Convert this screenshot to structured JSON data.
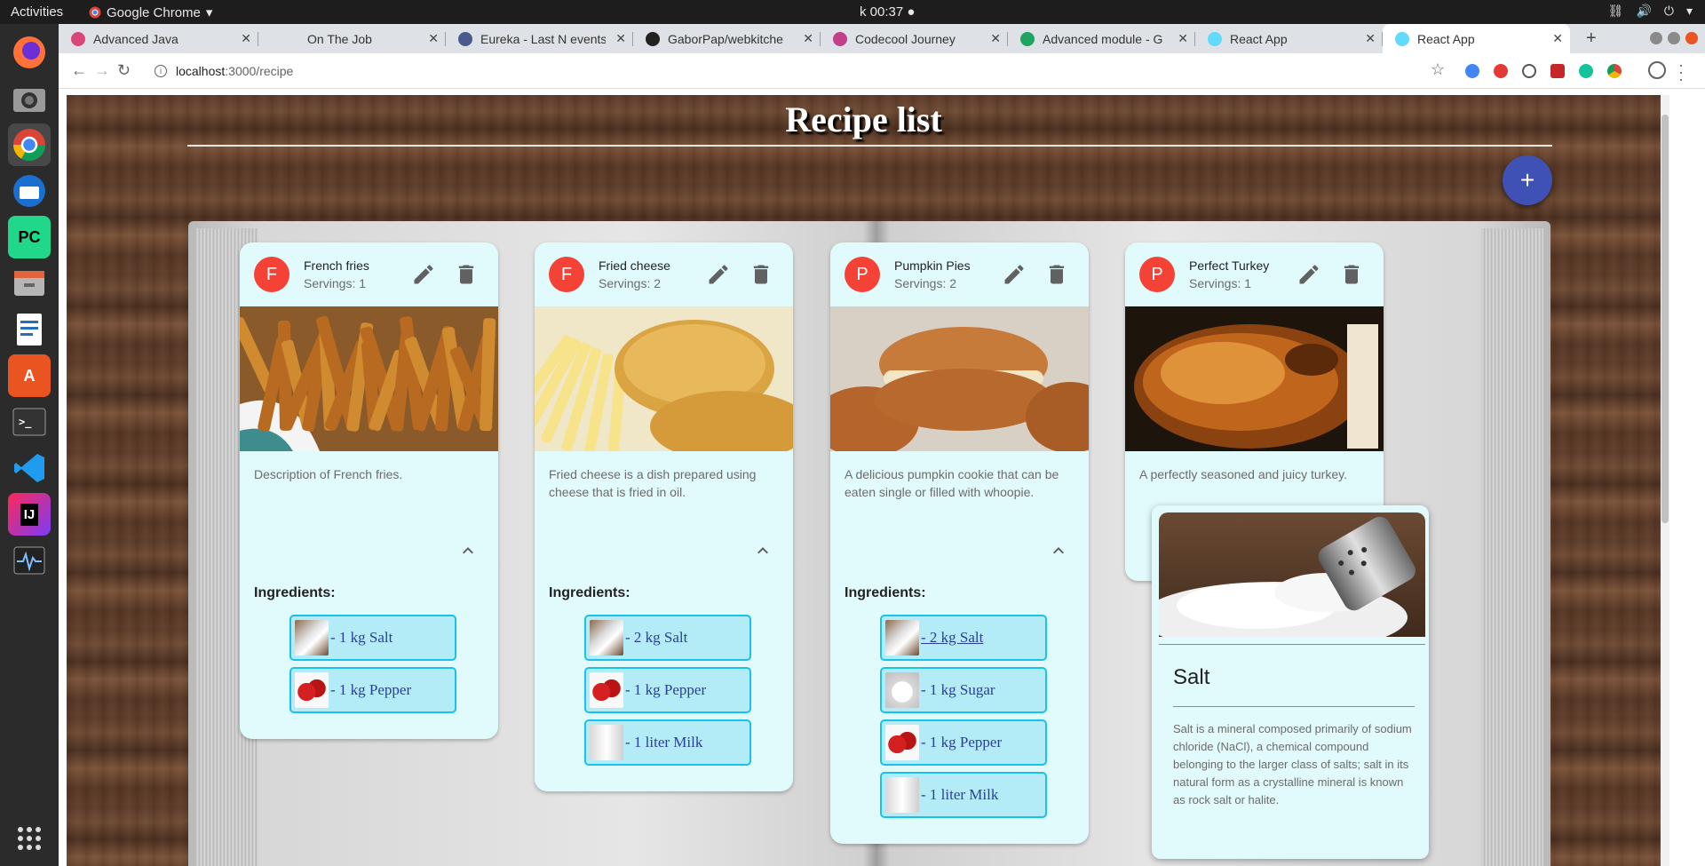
{
  "system": {
    "activities": "Activities",
    "app_name": "Google Chrome",
    "clock": "k 00:37 ●"
  },
  "browser": {
    "tabs": [
      {
        "label": "Advanced Java",
        "icon": "codecool-icon"
      },
      {
        "label": "On The Job",
        "icon": "blank-page-icon"
      },
      {
        "label": "Eureka - Last N events",
        "icon": "eureka-icon"
      },
      {
        "label": "GaborPap/webkitche",
        "icon": "github-icon"
      },
      {
        "label": "Codecool Journey",
        "icon": "codecool-icon"
      },
      {
        "label": "Advanced module - G",
        "icon": "google-drive-icon"
      },
      {
        "label": "React App",
        "icon": "react-icon"
      },
      {
        "label": "React App",
        "icon": "react-icon",
        "active": true
      }
    ],
    "url_host": "localhost",
    "url_path": ":3000/recipe"
  },
  "page": {
    "title": "Recipe list",
    "add_label": "+"
  },
  "recipes": [
    {
      "avatar": "F",
      "title": "French fries",
      "servings": "Servings: 1",
      "description": "Description of French fries.",
      "image": "french-fries-photo",
      "ingredients_label": "Ingredients:",
      "ingredients": [
        {
          "text": "- 1 kg Salt",
          "thumb": "salt-photo"
        },
        {
          "text": "- 1 kg Pepper",
          "thumb": "pepper-photo"
        }
      ]
    },
    {
      "avatar": "F",
      "title": "Fried cheese",
      "servings": "Servings: 2",
      "description": "Fried cheese is a dish prepared using cheese that is fried in oil.",
      "image": "fried-cheese-photo",
      "ingredients_label": "Ingredients:",
      "ingredients": [
        {
          "text": "- 2 kg Salt",
          "thumb": "salt-photo"
        },
        {
          "text": "- 1 kg Pepper",
          "thumb": "pepper-photo"
        },
        {
          "text": "- 1 liter Milk",
          "thumb": "milk-photo"
        }
      ]
    },
    {
      "avatar": "P",
      "title": "Pumpkin Pies",
      "servings": "Servings: 2",
      "description": "A delicious pumpkin cookie that can be eaten single or filled with whoopie.",
      "image": "pumpkin-pie-photo",
      "ingredients_label": "Ingredients:",
      "ingredients": [
        {
          "text": "- 2 kg Salt",
          "thumb": "salt-photo"
        },
        {
          "text": "- 1 kg Sugar",
          "thumb": "sugar-photo"
        },
        {
          "text": "- 1 kg Pepper",
          "thumb": "pepper-photo"
        },
        {
          "text": "- 1 liter Milk",
          "thumb": "milk-photo"
        }
      ]
    },
    {
      "avatar": "P",
      "title": "Perfect Turkey",
      "servings": "Servings: 1",
      "description": "A perfectly seasoned and juicy turkey.",
      "image": "turkey-photo"
    }
  ],
  "popup": {
    "title": "Salt",
    "description": "Salt is a mineral composed primarily of sodium chloride (NaCl), a chemical compound belonging to the larger class of salts; salt in its natural form as a crystalline mineral is known as rock salt or halite.",
    "image": "salt-shaker-photo"
  },
  "colors": {
    "avatar": "#f44336",
    "fab": "#3f51b5",
    "card_bg": "#e1fbfc",
    "chip_border": "#19c2e8",
    "chip_bg": "#b3ebf7",
    "ingredient_text": "#2a3f9a"
  }
}
